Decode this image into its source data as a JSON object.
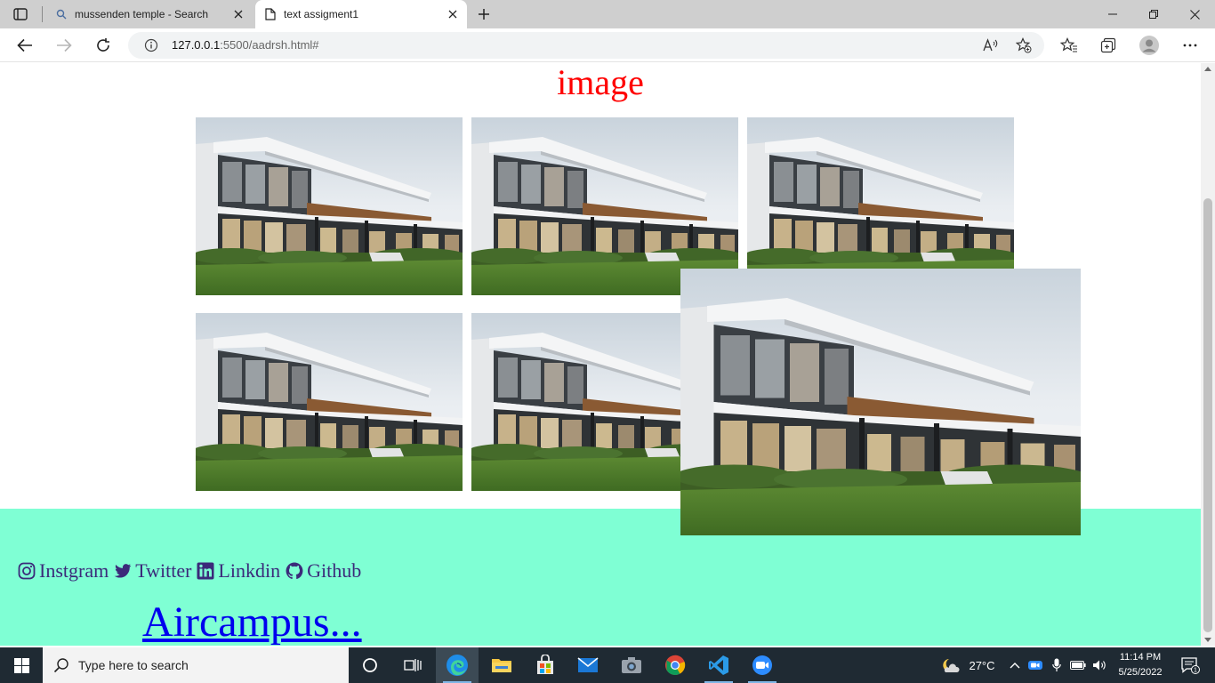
{
  "browser": {
    "tabs": [
      {
        "title": "mussenden temple - Search",
        "active": false,
        "icon": "search-icon"
      },
      {
        "title": "text assigment1",
        "active": true,
        "icon": "page-icon"
      }
    ],
    "address": {
      "host": "127.0.0.1",
      "path": ":5500/aadrsh.html#"
    }
  },
  "page": {
    "heading": "image",
    "heading_color": "#ff0000",
    "gallery": {
      "image_subject": "modern-house-photo",
      "image_count": 6,
      "hovered_index": 5
    },
    "footer": {
      "background": "#7fffd4",
      "social_links": [
        {
          "label": "Instgram",
          "icon": "instagram-icon"
        },
        {
          "label": "Twitter",
          "icon": "twitter-icon"
        },
        {
          "label": "Linkdin",
          "icon": "linkedin-icon"
        },
        {
          "label": "Github",
          "icon": "github-icon"
        }
      ],
      "brand_link": "Aircampus..."
    }
  },
  "taskbar": {
    "search_placeholder": "Type here to search",
    "apps": [
      "cortana-icon",
      "task-view-icon",
      "edge-icon",
      "file-explorer-icon",
      "store-icon",
      "mail-icon",
      "camera-icon",
      "chrome-icon",
      "vscode-icon",
      "zoom-icon"
    ],
    "weather": "27°C",
    "time": "11:14 PM",
    "date": "5/25/2022",
    "notification_count": "1"
  }
}
